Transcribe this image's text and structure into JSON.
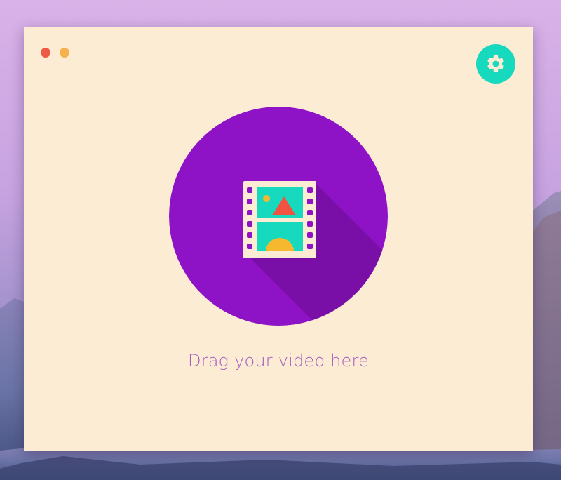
{
  "window": {
    "traffic_lights": [
      {
        "name": "close",
        "color": "#ee5a45"
      },
      {
        "name": "minimize",
        "color": "#f3b24e"
      }
    ],
    "background_color": "#fcecd3"
  },
  "settings": {
    "icon": "gear-icon",
    "button_color": "#17d9bd",
    "icon_color": "#fcecd3"
  },
  "dropzone": {
    "icon": "film-image-icon",
    "circle_color": "#8f13c6",
    "shadow_color": "#7a0fa8",
    "label": "Drag your video here",
    "label_color": "#a55ec0"
  },
  "colors": {
    "film_strip": "#fcecd3",
    "film_hole": "#8f13c6",
    "frame_teal": "#17d9bd",
    "triangle": "#f0533f",
    "sun": "#f5b82e"
  }
}
